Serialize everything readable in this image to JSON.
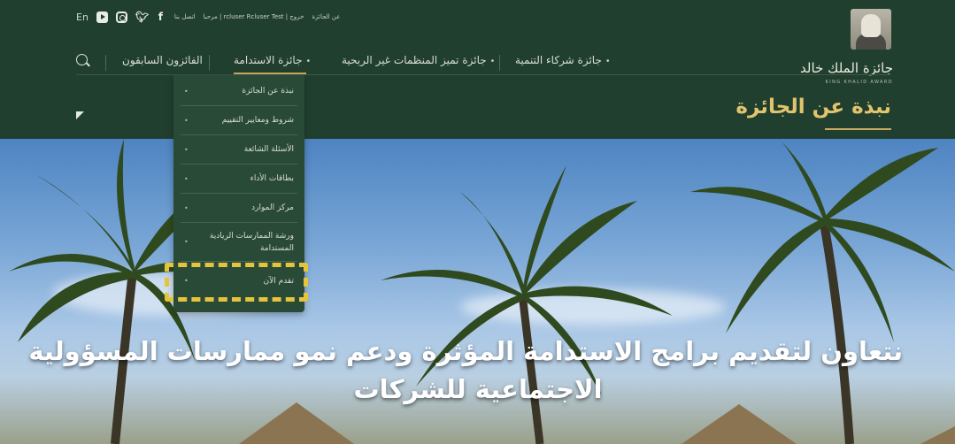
{
  "topbar": {
    "lang": "En",
    "links": [
      "عن الجائزة",
      "مرحبا | rcluser Rcluser Test | خروج",
      "اتصل بنا"
    ]
  },
  "brand": {
    "name_ar": "جائزة الملك خالد",
    "name_en": "KING KHALID AWARD"
  },
  "nav": {
    "items": [
      {
        "label": "جائزة شركاء التنمية",
        "has_dropdown": true
      },
      {
        "label": "جائزة تميز المنظمات غير الربحية",
        "has_dropdown": true
      },
      {
        "label": "جائزة الاستدامة",
        "has_dropdown": true,
        "active": true
      },
      {
        "label": "الفائزون السابقون",
        "has_dropdown": false
      }
    ],
    "search_icon": "search-icon"
  },
  "page": {
    "title": "نبذة عن الجائزة"
  },
  "dropdown": {
    "items": [
      "نبذة عن الجائزة",
      "شروط ومعايير التقييم",
      "الأسئلة الشائعة",
      "بطاقات الأداء",
      "مركز الموارد",
      "ورشة الممارسات الريادية المستدامة",
      "تقدم الآن"
    ]
  },
  "hero": {
    "line1": "نتعاون لتقديم برامج الاستدامة المؤثرة ودعم نمو ممارسات المسؤولية",
    "line2": "الاجتماعية للشركات"
  },
  "colors": {
    "header_bg": "#213f2e",
    "accent_gold": "#c9ab5f",
    "highlight": "#e5c43b"
  }
}
